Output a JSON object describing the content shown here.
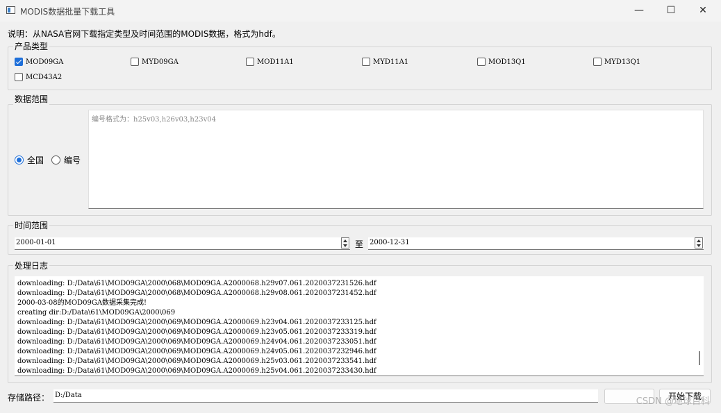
{
  "window": {
    "title": "MODIS数据批量下载工具",
    "minimize_glyph": "—",
    "maximize_glyph": "☐",
    "close_glyph": "✕"
  },
  "description": "说明：从NASA官网下载指定类型及时间范围的MODIS数据，格式为hdf。",
  "product_group": {
    "title": "产品类型",
    "items": [
      {
        "label": "MOD09GA",
        "checked": true
      },
      {
        "label": "MYD09GA",
        "checked": false
      },
      {
        "label": "MOD11A1",
        "checked": false
      },
      {
        "label": "MYD11A1",
        "checked": false
      },
      {
        "label": "MOD13Q1",
        "checked": false
      },
      {
        "label": "MYD13Q1",
        "checked": false
      },
      {
        "label": "MCD43A2",
        "checked": false
      }
    ]
  },
  "range_group": {
    "title": "数据范围",
    "radio_all": "全国",
    "radio_code": "编号",
    "selected": "全国",
    "tiles_placeholder": "编号格式为：h25v03,h26v03,h23v04"
  },
  "time_group": {
    "title": "时间范围",
    "start_date": "2000-01-01",
    "separator": "至",
    "end_date": "2000-12-31"
  },
  "log_group": {
    "title": "处理日志",
    "lines": [
      "downloading: D:/Data\\61\\MOD09GA\\2000\\068\\MOD09GA.A2000068.h29v07.061.2020037231526.hdf",
      "downloading: D:/Data\\61\\MOD09GA\\2000\\068\\MOD09GA.A2000068.h29v08.061.2020037231452.hdf",
      "2000-03-08的MOD09GA数据采集完成!",
      "creating dir:D:/Data\\61\\MOD09GA\\2000\\069",
      "downloading: D:/Data\\61\\MOD09GA\\2000\\069\\MOD09GA.A2000069.h23v04.061.2020037233125.hdf",
      "downloading: D:/Data\\61\\MOD09GA\\2000\\069\\MOD09GA.A2000069.h23v05.061.2020037233319.hdf",
      "downloading: D:/Data\\61\\MOD09GA\\2000\\069\\MOD09GA.A2000069.h24v04.061.2020037233051.hdf",
      "downloading: D:/Data\\61\\MOD09GA\\2000\\069\\MOD09GA.A2000069.h24v05.061.2020037232946.hdf",
      "downloading: D:/Data\\61\\MOD09GA\\2000\\069\\MOD09GA.A2000069.h25v03.061.2020037233541.hdf",
      "downloading: D:/Data\\61\\MOD09GA\\2000\\069\\MOD09GA.A2000069.h25v04.061.2020037233430.hdf"
    ]
  },
  "storage": {
    "label": "存储路径：",
    "path": "D:/Data"
  },
  "buttons": {
    "secondary_label": "",
    "start_label": "开始下载"
  },
  "watermark": "CSDN @地球百科",
  "colors": {
    "accent": "#1e6fd9",
    "background": "#f0f0f0"
  }
}
